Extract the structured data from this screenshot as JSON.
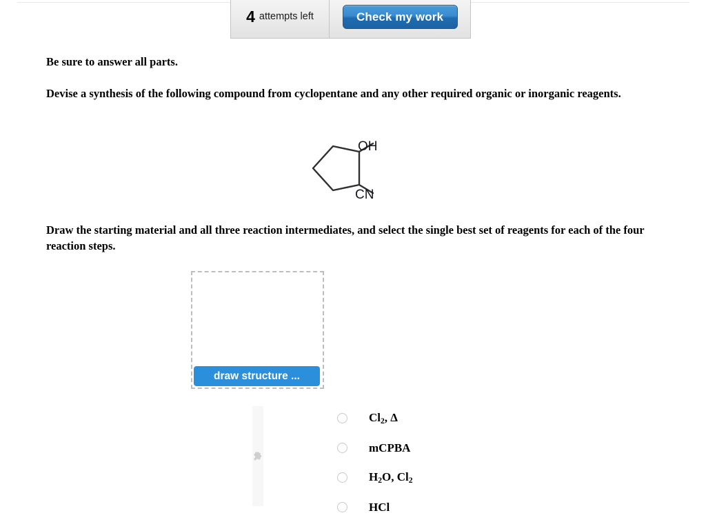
{
  "toolbar": {
    "attempts_count": "4",
    "attempts_label": "attempts left",
    "check_button_label": "Check my work"
  },
  "question": {
    "answer_all_parts": "Be sure to answer all parts.",
    "prompt": "Devise a synthesis of the following compound from cyclopentane and any other required organic or inorganic reagents.",
    "draw_instruction": "Draw the starting material and all three reaction intermediates, and select the single best set of reagents for each of the four reaction steps."
  },
  "molecule": {
    "name": "2-hydroxycyclopentanecarbonitrile",
    "hydroxyl_label": "OH",
    "nitrile_label": "CN",
    "bond_color": "#2f2f2f",
    "label_color": "#17171f"
  },
  "answer_area": {
    "draw_structure_label": "draw structure ...",
    "draw_button_color": "#2c8fdb",
    "box_border_color": "#bdbdbd",
    "plugin_icon": "puzzle-piece-icon"
  },
  "reagent_options": [
    {
      "id": "option-cl2-heat",
      "html": "Cl<sub>2</sub>, &Delta;",
      "text": "Cl2, Δ",
      "selected": false
    },
    {
      "id": "option-mcpba",
      "html": "mCPBA",
      "text": "mCPBA",
      "selected": false
    },
    {
      "id": "option-h2o-cl2",
      "html": "H<sub>2</sub>O, Cl<sub>2</sub>",
      "text": "H2O, Cl2",
      "selected": false
    },
    {
      "id": "option-hcl",
      "html": "HCl",
      "text": "HCl",
      "selected": false
    }
  ],
  "colors": {
    "accent_blue": "#2c8fdb",
    "button_blue": "#1f6cb2",
    "panel_gray": "#e2e2e2"
  }
}
